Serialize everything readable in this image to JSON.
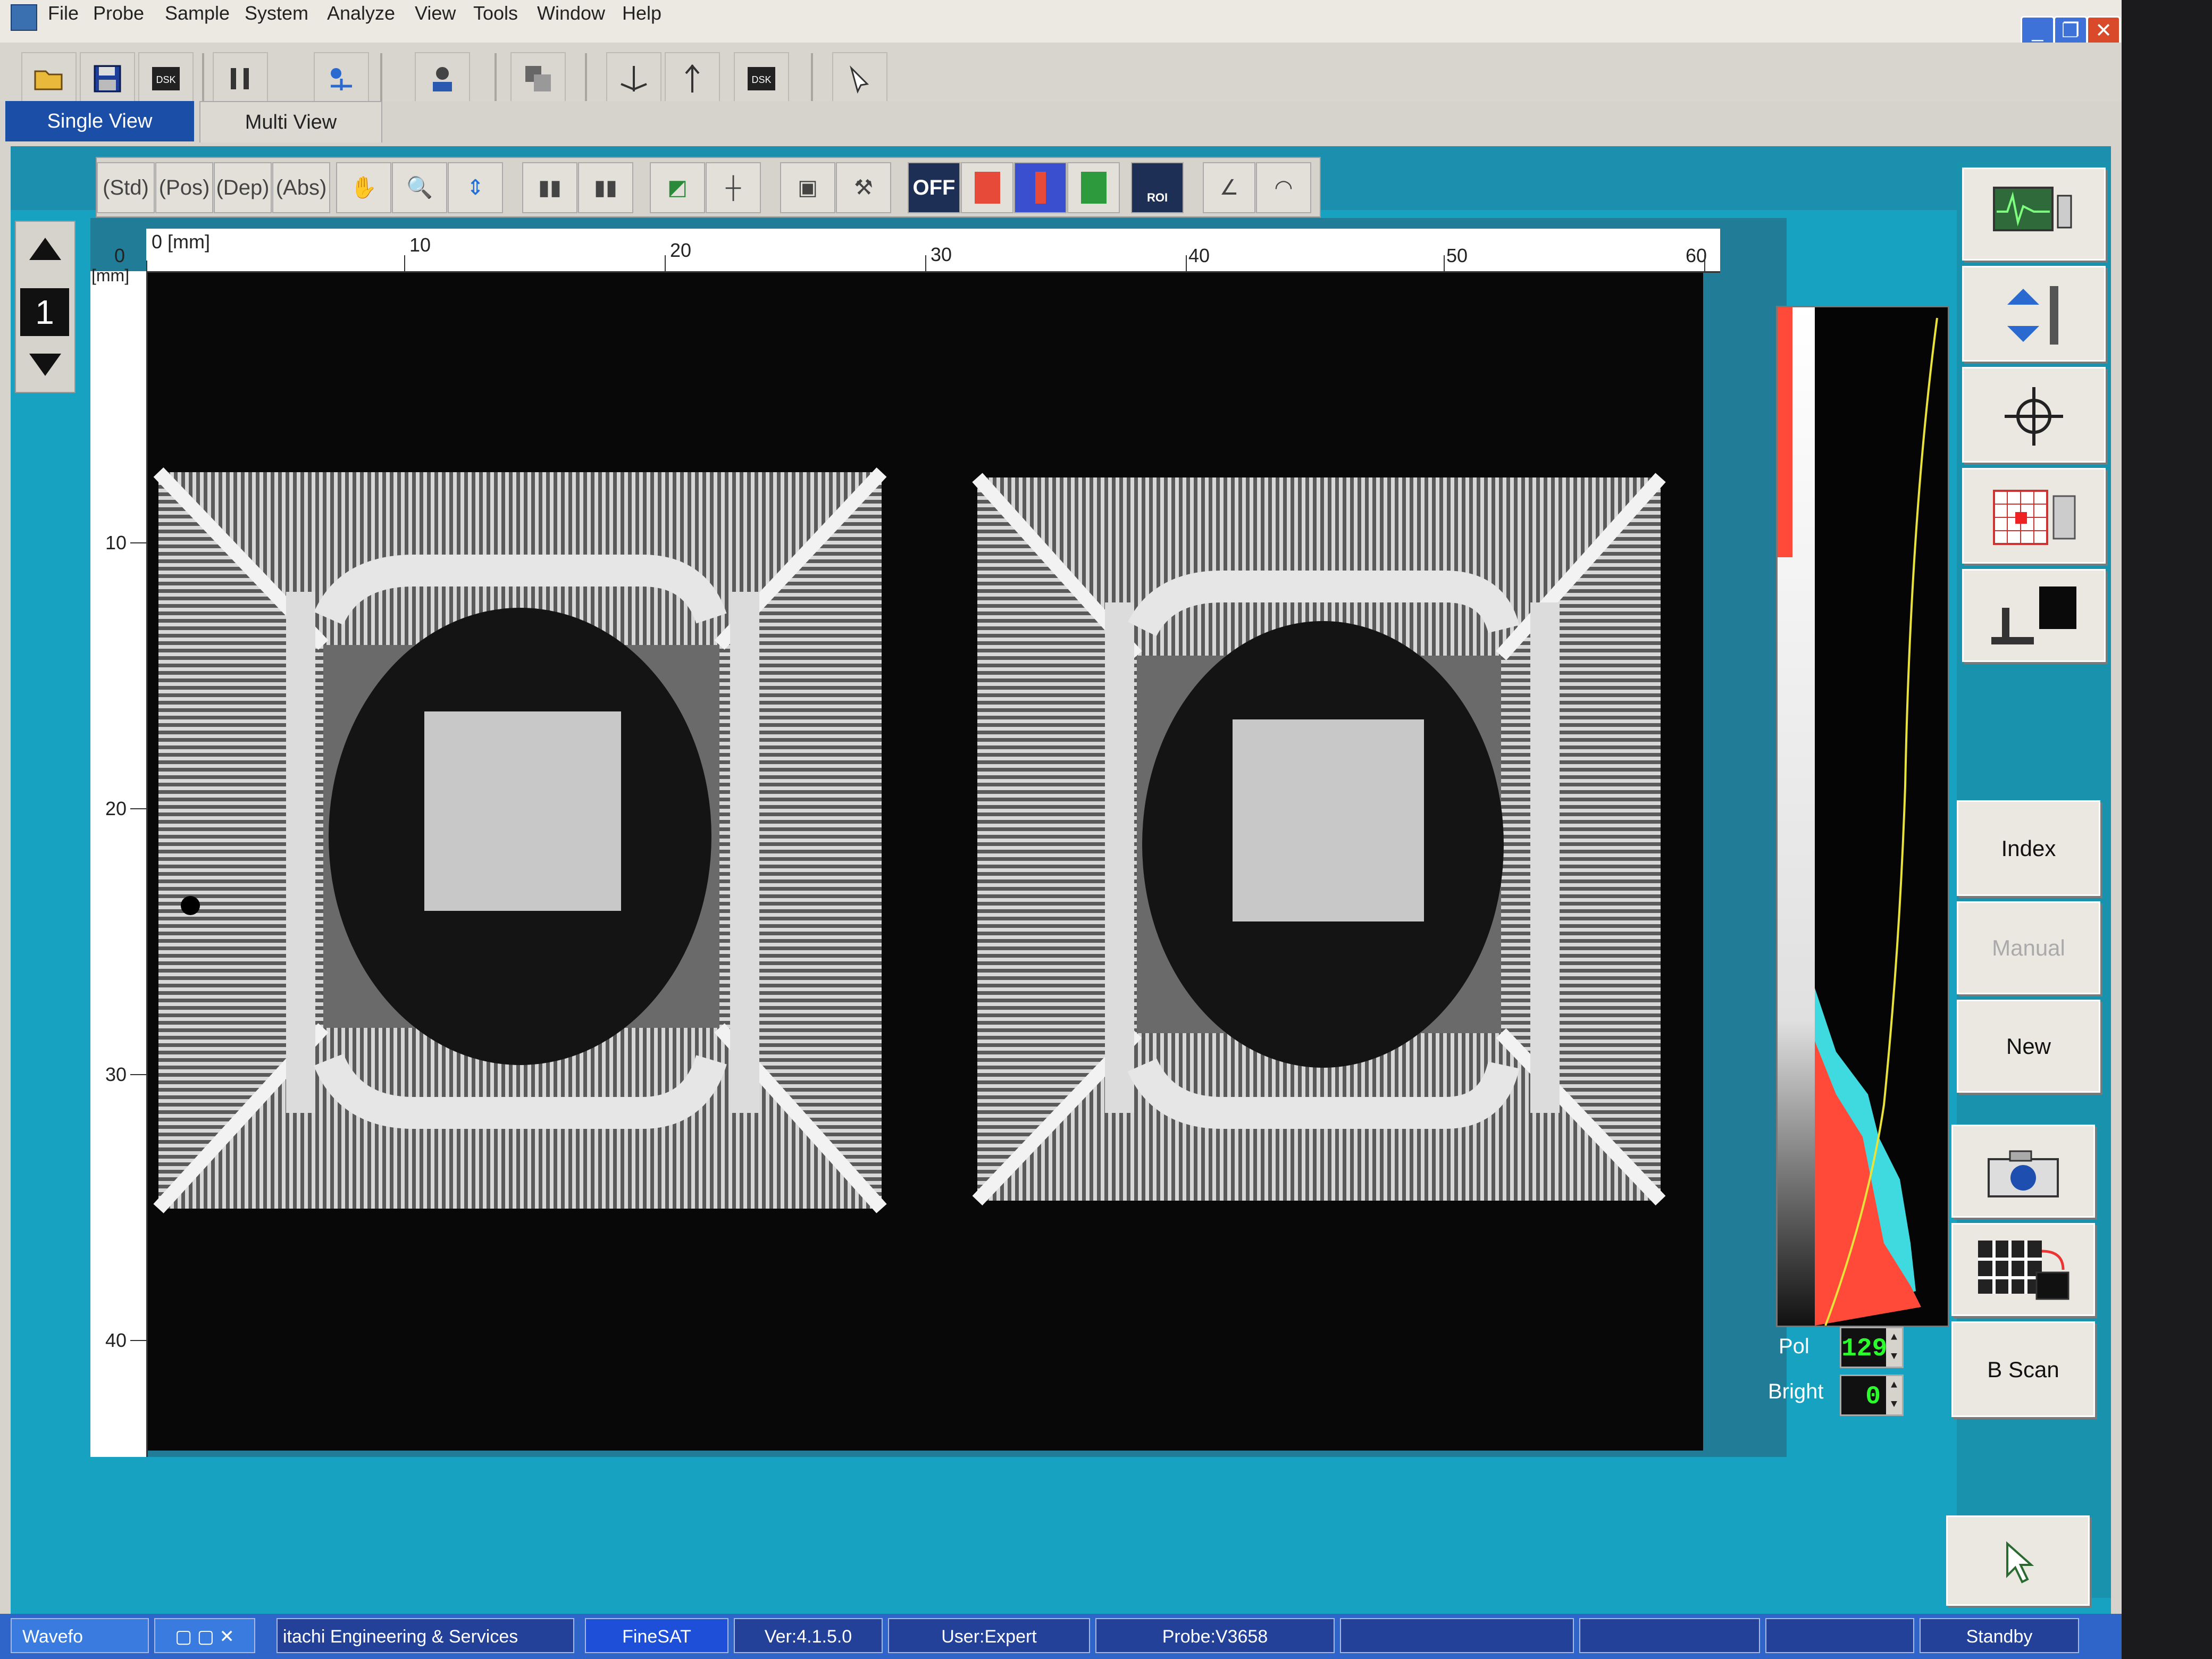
{
  "menubar": {
    "items": [
      "File",
      "Probe",
      "Sample",
      "System",
      "Analyze",
      "View",
      "Tools",
      "Window",
      "Help"
    ]
  },
  "tabs": {
    "single_view": "Single View",
    "multi_view": "Multi View"
  },
  "image_tools": {
    "std": "(Std)",
    "pos": "(Pos)",
    "dep": "(Dep)",
    "abs": "(Abs)",
    "off": "OFF",
    "roi": "ROI"
  },
  "view": {
    "layer_number": "1",
    "x_unit": "0 [mm]",
    "y_unit": "[mm]",
    "x_ticks": [
      "10",
      "20",
      "30",
      "40",
      "50",
      "60"
    ],
    "y_ticks": [
      "0",
      "10",
      "20",
      "30",
      "40"
    ]
  },
  "histogram": {
    "pol_label": "Pol",
    "pol_value": "129",
    "bright_label": "Bright",
    "bright_value": "0"
  },
  "right_panel": {
    "index": "Index",
    "manual": "Manual",
    "new": "New",
    "bscan": "B Scan"
  },
  "statusbar": {
    "start": "Wavefo",
    "company": "itachi Engineering & Services",
    "app": "FineSAT",
    "version": "Ver:4.1.5.0",
    "user": "User:Expert",
    "probe": "Probe:V3658",
    "state": "Standby"
  },
  "colors": {
    "workspace": "#18a2c2",
    "accent_tab": "#1b4ea6",
    "status_bar": "#2f64c9",
    "histogram_red": "#ff4a3a",
    "histogram_cyan": "#3fd9e0",
    "spin_text": "#2bff2b"
  }
}
